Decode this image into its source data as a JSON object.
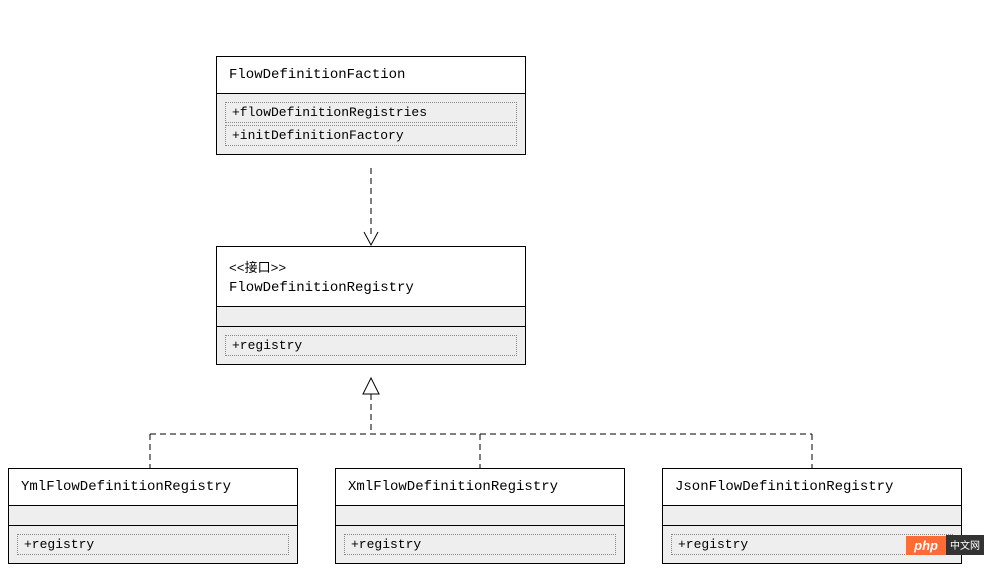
{
  "classes": {
    "factory": {
      "name": "FlowDefinitionFaction",
      "attributes": [
        "+flowDefinitionRegistries"
      ],
      "operations": [
        "+initDefinitionFactory"
      ]
    },
    "registry": {
      "stereotype": "<<接口>>",
      "name": "FlowDefinitionRegistry",
      "operations": [
        "+registry"
      ]
    },
    "yml": {
      "name": "YmlFlowDefinitionRegistry",
      "operations": [
        "+registry"
      ]
    },
    "xml": {
      "name": "XmlFlowDefinitionRegistry",
      "operations": [
        "+registry"
      ]
    },
    "json": {
      "name": "JsonFlowDefinitionRegistry",
      "operations": [
        "+registry"
      ]
    }
  },
  "watermark": {
    "php": "php",
    "cn": "中文网"
  }
}
